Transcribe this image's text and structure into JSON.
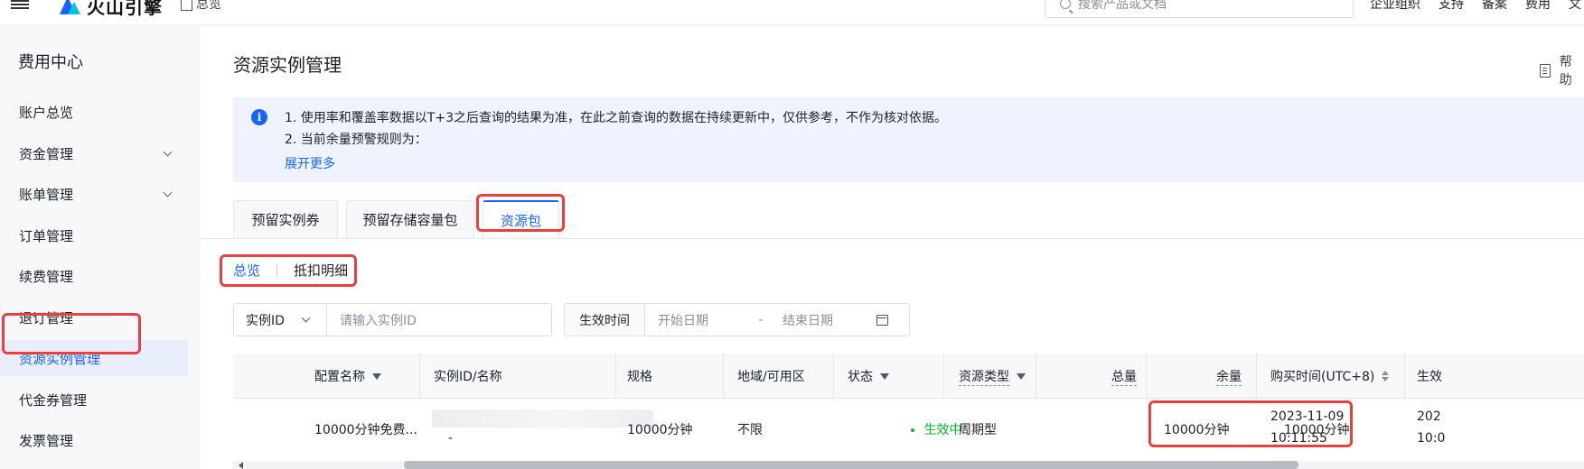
{
  "topbar": {
    "logo_text": "火山引擎",
    "home_label": "总览",
    "search_placeholder": "搜索产品或文档",
    "links": [
      "企业组织",
      "支持",
      "备案",
      "费用",
      "文"
    ]
  },
  "sidebar": {
    "title": "费用中心",
    "items": [
      {
        "label": "账户总览"
      },
      {
        "label": "资金管理"
      },
      {
        "label": "账单管理"
      },
      {
        "label": "订单管理"
      },
      {
        "label": "续费管理"
      },
      {
        "label": "退订管理"
      },
      {
        "label": "资源实例管理"
      },
      {
        "label": "代金券管理"
      },
      {
        "label": "发票管理"
      }
    ]
  },
  "page": {
    "title": "资源实例管理",
    "help_label": "帮助"
  },
  "notice": {
    "line1": "1. 使用率和覆盖率数据以T+3之后查询的结果为准，在此之前查询的数据在持续更新中，仅供参考，不作为核对依据。",
    "line2": "2. 当前余量预警规则为：",
    "more": "展开更多"
  },
  "tabs": [
    {
      "label": "预留实例券"
    },
    {
      "label": "预留存储容量包"
    },
    {
      "label": "资源包"
    }
  ],
  "sub_tabs": [
    {
      "label": "总览"
    },
    {
      "label": "抵扣明细"
    }
  ],
  "filters": {
    "select_label": "实例ID",
    "input_placeholder": "请输入实例ID",
    "date_label": "生效时间",
    "start_placeholder": "开始日期",
    "separator": "-",
    "end_placeholder": "结束日期"
  },
  "table": {
    "headers": {
      "config": "配置名称",
      "instance": "实例ID/名称",
      "spec": "规格",
      "region": "地域/可用区",
      "status": "状态",
      "type": "资源类型",
      "total": "总量",
      "remaining": "余量",
      "purchase": "购买时间(UTC+8)",
      "effective": "生效"
    },
    "row": {
      "config": "10000分钟免费...",
      "instance_sub": "-",
      "spec": "10000分钟",
      "region": "不限",
      "status": "生效中",
      "type": "周期型",
      "total": "10000分钟",
      "remaining": "10000分钟",
      "purchase_date": "2023-11-09",
      "purchase_time": "10:11:55",
      "effective_date": "202",
      "effective_time": "10:0"
    }
  }
}
